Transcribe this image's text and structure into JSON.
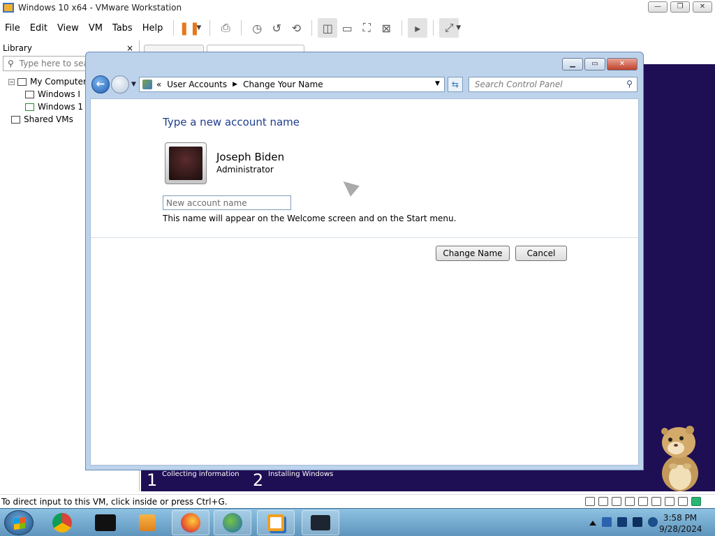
{
  "vmware": {
    "title": "Windows 10 x64 - VMware Workstation",
    "menu": [
      "File",
      "Edit",
      "View",
      "VM",
      "Tabs",
      "Help"
    ],
    "status": "To direct input to this VM, click inside or press Ctrl+G."
  },
  "library": {
    "title": "Library",
    "close": "×",
    "search_placeholder": "Type here to search",
    "search_visible": "Type here to sea",
    "tree": {
      "root": "My Computer",
      "child1": "Windows I",
      "child2": "Windows 1",
      "shared": "Shared VMs"
    }
  },
  "installer": {
    "step1_num": "1",
    "step1_label": "Collecting information",
    "step2_num": "2",
    "step2_label": "Installing Windows"
  },
  "dialog": {
    "breadcrumb_chevron": "«",
    "breadcrumb": [
      "User Accounts",
      "Change Your Name"
    ],
    "search_placeholder": "Search Control Panel",
    "heading": "Type a new account name",
    "user_name": "Joseph Biden",
    "user_role": "Administrator",
    "input_placeholder": "New account name",
    "hint": "This name will appear on the Welcome screen and on the Start menu.",
    "change_button": "Change Name",
    "cancel_button": "Cancel"
  },
  "taskbar": {
    "time": "3:58 PM",
    "date": "9/28/2024"
  },
  "colors": {
    "installer_bg": "#1e0e54",
    "heading": "#1e3c8c",
    "dialog_frame": "#bdd3ec"
  }
}
